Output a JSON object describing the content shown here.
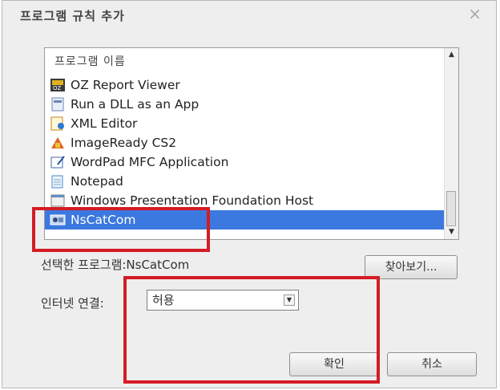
{
  "dialog": {
    "title": "프로그램 규칙 추가",
    "close_glyph": "×"
  },
  "program_list": {
    "header": "프로그램 이름",
    "items": [
      {
        "label": "OZ Report Viewer",
        "icon": "oz-report-icon",
        "selected": false
      },
      {
        "label": "Run a DLL as an App",
        "icon": "generic-app-icon",
        "selected": false
      },
      {
        "label": "XML Editor",
        "icon": "xml-editor-icon",
        "selected": false
      },
      {
        "label": "ImageReady CS2",
        "icon": "imageready-icon",
        "selected": false
      },
      {
        "label": "WordPad MFC Application",
        "icon": "wordpad-icon",
        "selected": false
      },
      {
        "label": "Notepad",
        "icon": "notepad-icon",
        "selected": false
      },
      {
        "label": "Windows Presentation Foundation Host",
        "icon": "wpf-host-icon",
        "selected": false
      },
      {
        "label": "NsCatCom",
        "icon": "nscatcom-icon",
        "selected": true
      }
    ]
  },
  "selected_program": {
    "text": "선택한 프로그램:NsCatCom"
  },
  "browse_button": {
    "label": "찾아보기..."
  },
  "internet": {
    "label": "인터넷 연결:",
    "selected_value": "허용"
  },
  "buttons": {
    "ok_label": "확인",
    "cancel_label": "취소"
  },
  "colors": {
    "selection": "#3b78e0",
    "highlight_box": "#d51b24"
  }
}
